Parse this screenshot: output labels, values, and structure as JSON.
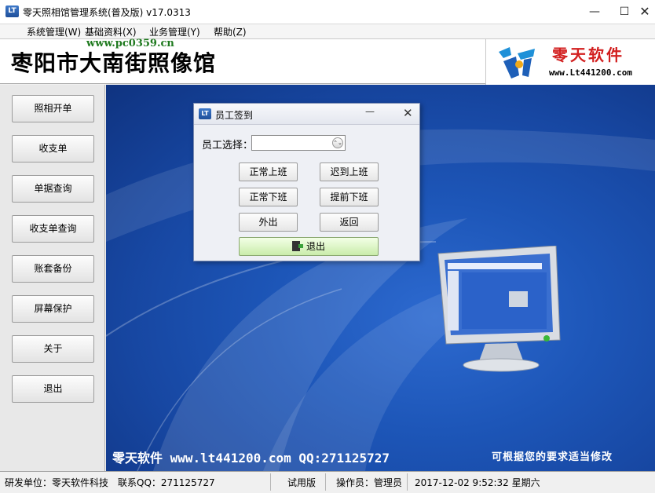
{
  "window": {
    "title": "零天照相馆管理系统(普及版)  v17.0313",
    "minimize": "—",
    "maximize": "☐",
    "close": "✕"
  },
  "menu": {
    "items": [
      "系统管理(W)",
      "基础资料(X)",
      "业务管理(Y)",
      "帮助(Z)"
    ]
  },
  "watermark": "www.pc0359.cn",
  "header": {
    "title": "枣阳市大南街照像馆",
    "logo_cn": "零天软件",
    "logo_url": "www.Lt441200.com"
  },
  "sidebar": {
    "items": [
      "照相开单",
      "收支单",
      "单据查询",
      "收支单查询",
      "账套备份",
      "屏幕保护",
      "关于",
      "退出"
    ]
  },
  "main": {
    "footer_text": "零天软件  www.lt441200.com  QQ:271125727",
    "footer_slogan": "可根据您的要求适当修改"
  },
  "dialog": {
    "title": "员工签到",
    "minimize": "—",
    "close": "✕",
    "employee_label": "员工选择：",
    "employee_value": "",
    "buttons": [
      "正常上班",
      "迟到上班",
      "正常下班",
      "提前下班",
      "外出",
      "返回"
    ],
    "exit_label": "退出"
  },
  "status": {
    "developer": "研发单位：零天软件科技",
    "contact": "联系QQ：271125727",
    "edition": "试用版",
    "operator": "操作员：管理员",
    "datetime": "2017-12-02   9:52:32 星期六"
  },
  "colors": {
    "desktop_blue": "#1d56b8",
    "logo_red": "#d21f1f",
    "watermark_green": "#1f7a1f",
    "exit_green": "#c9ecaa"
  },
  "icons": {
    "app": "app-logo-icon",
    "exit": "door-exit-icon",
    "select": "dropdown-arrow-icon"
  }
}
